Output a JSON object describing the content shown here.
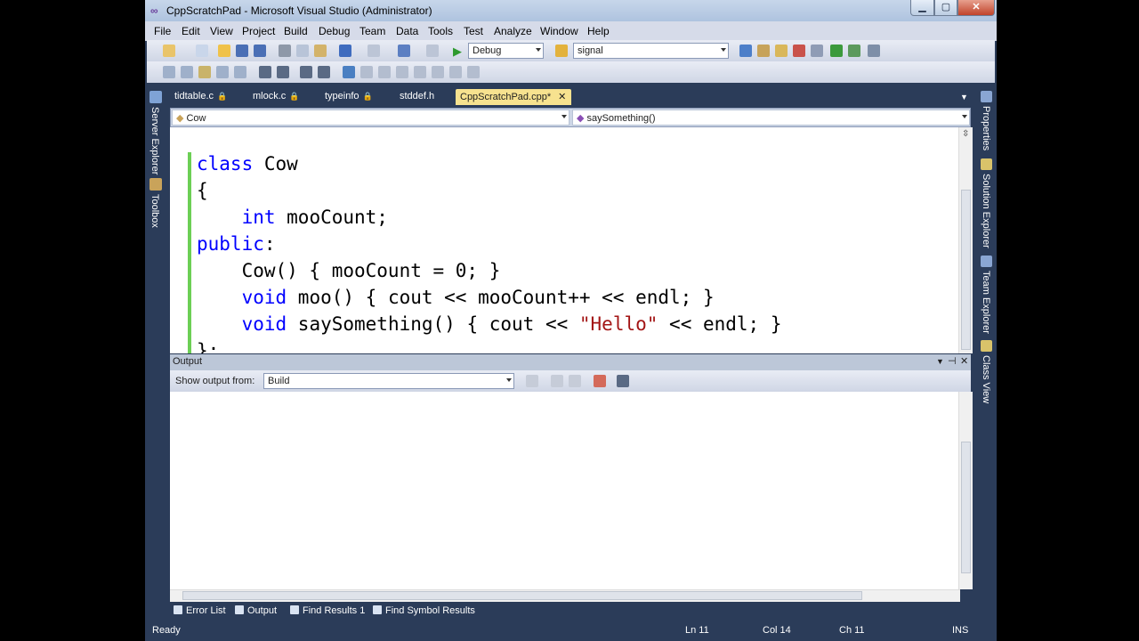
{
  "window": {
    "title": "CppScratchPad - Microsoft Visual Studio (Administrator)"
  },
  "menu": [
    "File",
    "Edit",
    "View",
    "Project",
    "Build",
    "Debug",
    "Team",
    "Data",
    "Tools",
    "Test",
    "Analyze",
    "Window",
    "Help"
  ],
  "toolbar": {
    "config": "Debug",
    "find": "signal"
  },
  "tabs": [
    {
      "label": "tidtable.c",
      "locked": true
    },
    {
      "label": "mlock.c",
      "locked": true
    },
    {
      "label": "typeinfo",
      "locked": true
    },
    {
      "label": "stddef.h",
      "locked": false
    },
    {
      "label": "CppScratchPad.cpp*",
      "active": true
    }
  ],
  "nav": {
    "type": "Cow",
    "member": "saySomething()"
  },
  "code": [
    {
      "parts": [
        {
          "t": "class",
          "c": "kw"
        },
        {
          "t": " Cow"
        }
      ]
    },
    {
      "parts": [
        {
          "t": "{"
        }
      ]
    },
    {
      "parts": [
        {
          "t": "    "
        },
        {
          "t": "int",
          "c": "kw"
        },
        {
          "t": " mooCount;"
        }
      ]
    },
    {
      "parts": [
        {
          "t": "public",
          "c": "kw"
        },
        {
          "t": ":"
        }
      ]
    },
    {
      "parts": [
        {
          "t": "    Cow() { mooCount = 0; }"
        }
      ]
    },
    {
      "parts": [
        {
          "t": "    "
        },
        {
          "t": "void",
          "c": "kw"
        },
        {
          "t": " moo() { cout << mooCount++ << endl; }"
        }
      ]
    },
    {
      "parts": [
        {
          "t": "    "
        },
        {
          "t": "void",
          "c": "kw"
        },
        {
          "t": " saySomething() { cout << "
        },
        {
          "t": "\"Hello\"",
          "c": "str"
        },
        {
          "t": " << endl; }"
        }
      ]
    },
    {
      "parts": [
        {
          "t": "};"
        }
      ]
    }
  ],
  "left_dock": [
    "Server Explorer",
    "Toolbox"
  ],
  "right_dock": [
    "Properties",
    "Solution Explorer",
    "Team Explorer",
    "Class View"
  ],
  "output": {
    "title": "Output",
    "show_from_label": "Show output from:",
    "source": "Build"
  },
  "bottom_tabs": [
    "Error List",
    "Output",
    "Find Results 1",
    "Find Symbol Results"
  ],
  "status": {
    "ready": "Ready",
    "ln": "Ln 11",
    "col": "Col 14",
    "ch": "Ch 11",
    "ins": "INS"
  }
}
